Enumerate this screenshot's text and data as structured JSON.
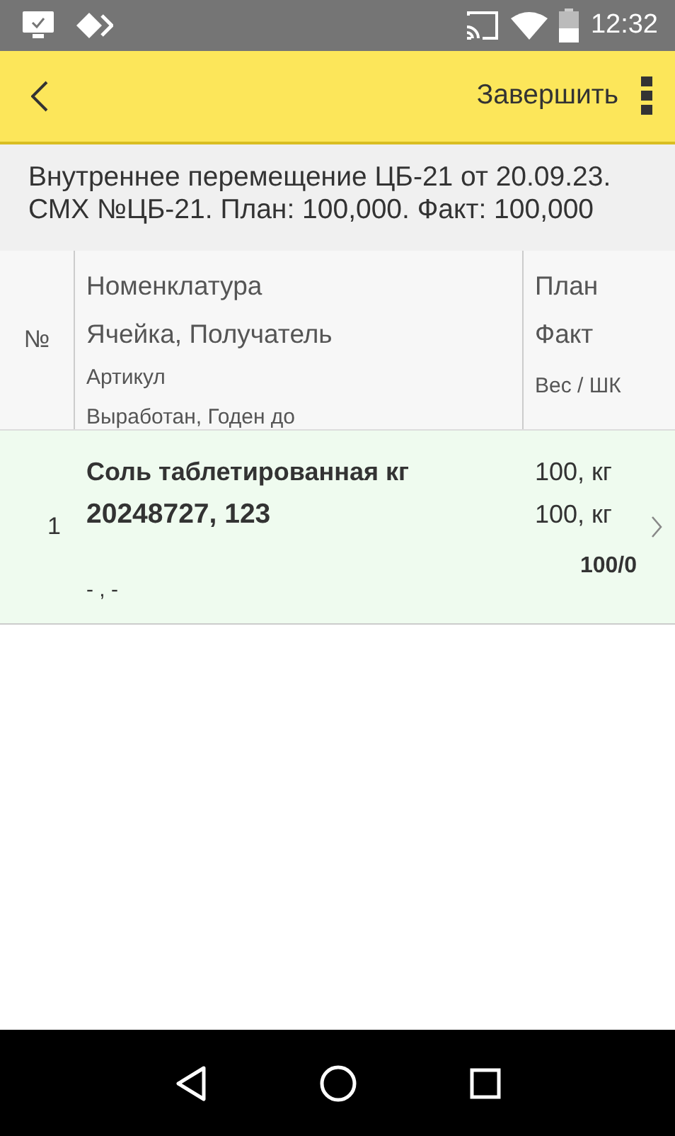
{
  "status_bar": {
    "time": "12:32"
  },
  "toolbar": {
    "action": "Завершить"
  },
  "document_title": "Внутреннее перемещение ЦБ-21 от 20.09.23. СМХ №ЦБ-21. План: 100,000. Факт: 100,000",
  "table": {
    "columns": {
      "number": "№",
      "name_lines": [
        "Номенклатура",
        "Ячейка, Получатель"
      ],
      "sub_lines": [
        "Артикул",
        "Выработан, Годен до"
      ],
      "qty_lines": [
        "План",
        "Факт"
      ],
      "weight": "Вес / ШК"
    },
    "rows": [
      {
        "number": "1",
        "name": "Соль таблетированная кг",
        "cell": "20248727, 123",
        "dates": "- , -",
        "plan": "100, кг",
        "fact": "100, кг",
        "weight": "100/0",
        "highlighted": true
      }
    ]
  }
}
